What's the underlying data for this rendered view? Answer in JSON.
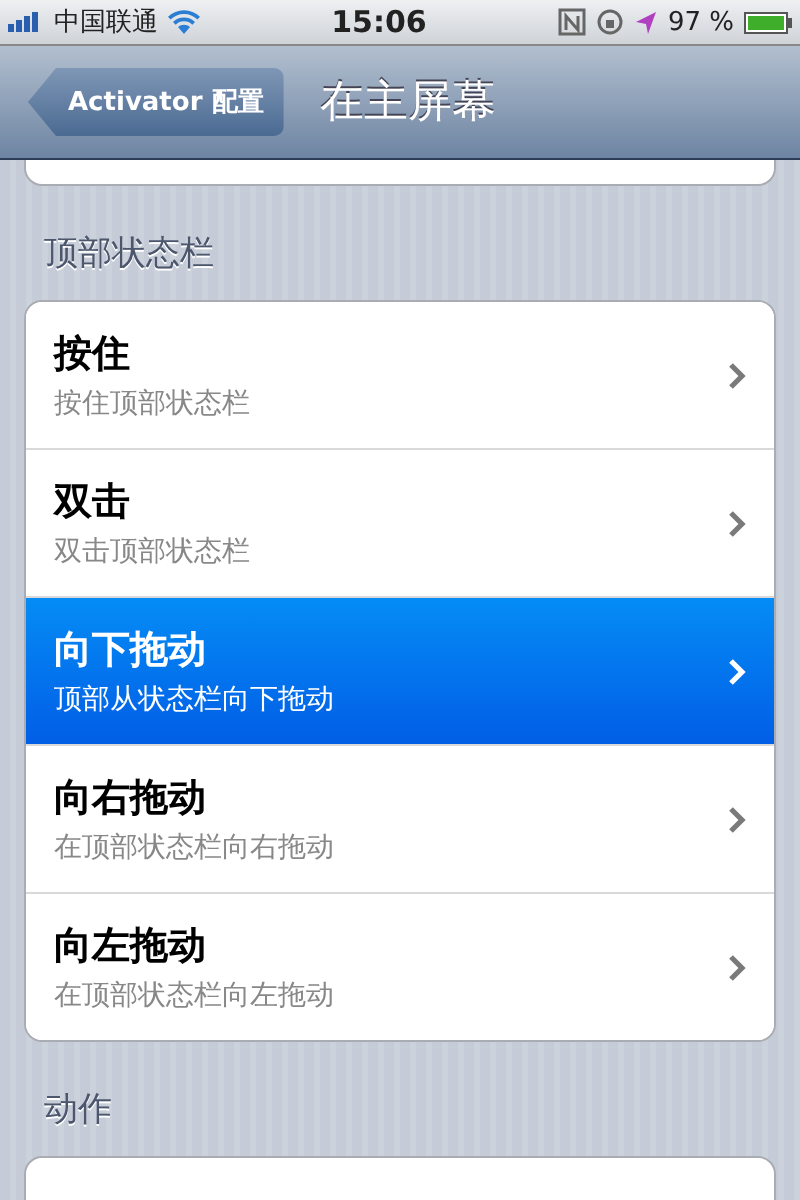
{
  "status_bar": {
    "carrier": "中国联通",
    "time": "15:06",
    "battery": "97 %"
  },
  "nav_bar": {
    "back": "Activator 配置",
    "title": "在主屏幕"
  },
  "sections": [
    {
      "header": "顶部状态栏",
      "rows": [
        {
          "title": "按住",
          "subtitle": "按住顶部状态栏",
          "selected": false
        },
        {
          "title": "双击",
          "subtitle": "双击顶部状态栏",
          "selected": false
        },
        {
          "title": "向下拖动",
          "subtitle": "顶部从状态栏向下拖动",
          "selected": true
        },
        {
          "title": "向右拖动",
          "subtitle": "在顶部状态栏向右拖动",
          "selected": false
        },
        {
          "title": "向左拖动",
          "subtitle": "在顶部状态栏向左拖动",
          "selected": false
        }
      ]
    },
    {
      "header": "动作"
    }
  ]
}
